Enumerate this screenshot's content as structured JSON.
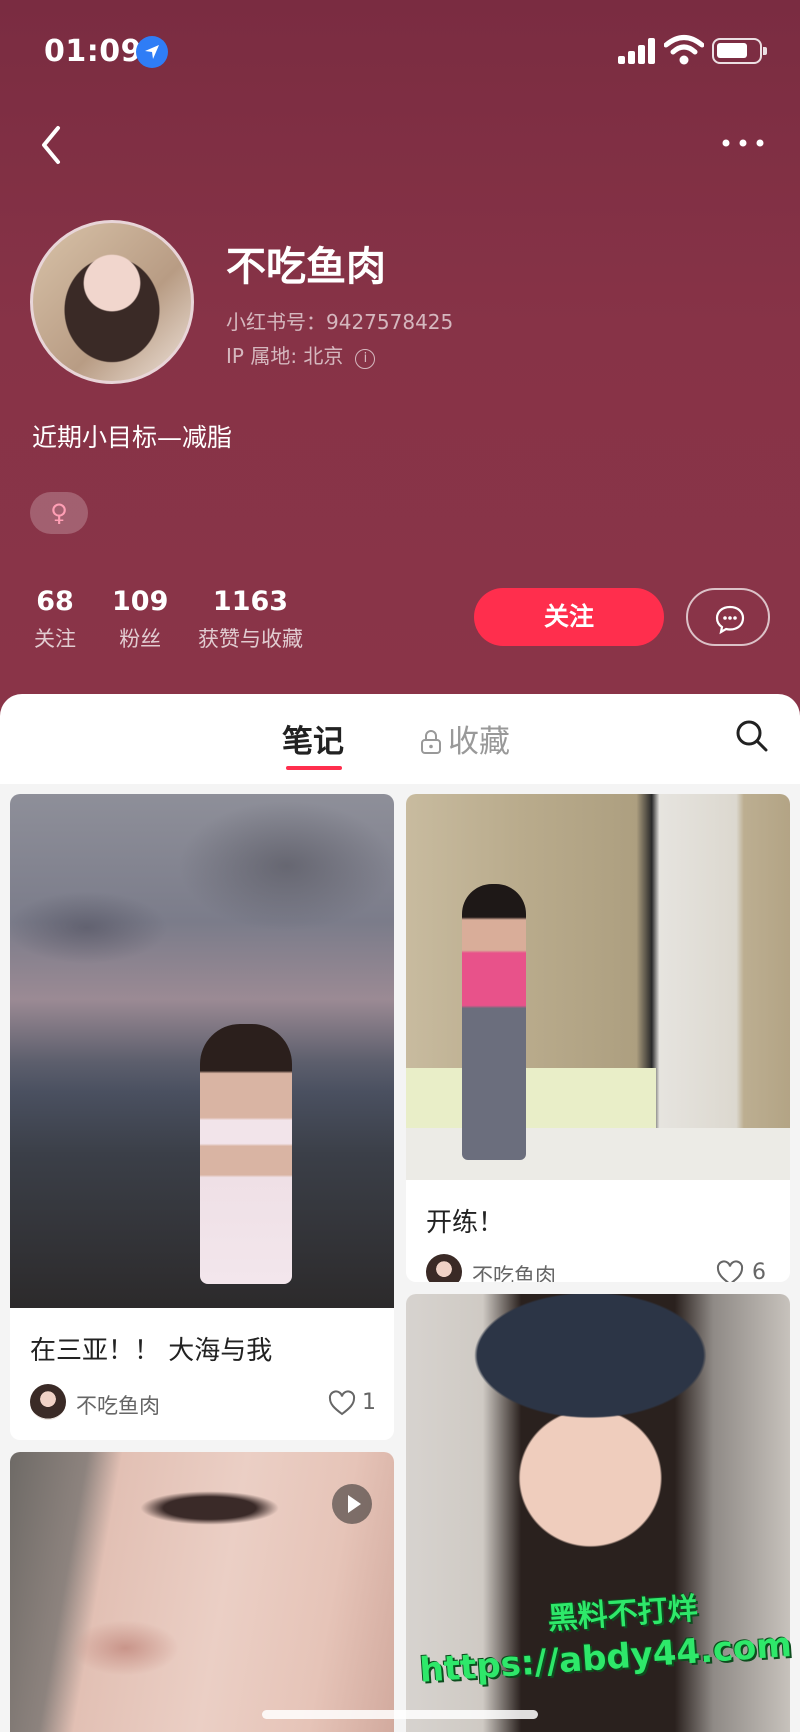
{
  "status_bar": {
    "time": "01:09"
  },
  "profile": {
    "name": "不吃鱼肉",
    "redbook_id": "小红书号：9427578425",
    "ip_location": "IP 属地: 北京",
    "bio": "近期小目标—减脂",
    "gender_symbol": "♀"
  },
  "stats": [
    {
      "value": "68",
      "label": "关注"
    },
    {
      "value": "109",
      "label": "粉丝"
    },
    {
      "value": "1163",
      "label": "获赞与收藏"
    }
  ],
  "actions": {
    "follow_label": "关注"
  },
  "tabs": {
    "notes": "笔记",
    "saves": "收藏"
  },
  "cards": [
    {
      "title": "在三亚！！ 大海与我",
      "author": "不吃鱼肉",
      "likes": "1"
    },
    {
      "title": "开练！",
      "author": "不吃鱼肉",
      "likes": "6"
    }
  ],
  "watermark": {
    "line1": "黑料不打烊",
    "line2": "https://abdy44.com"
  },
  "colors": {
    "header_bg": "#873347",
    "accent": "#ff2e4d"
  }
}
